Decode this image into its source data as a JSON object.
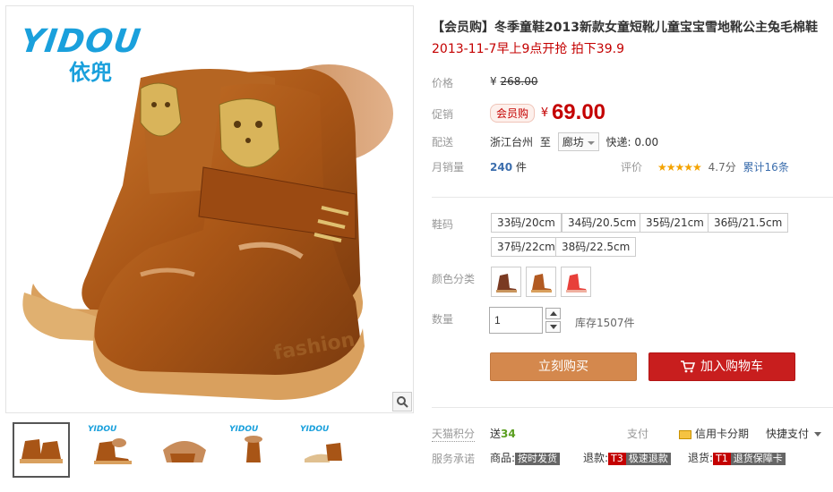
{
  "brand": {
    "logo_en": "YIDOU",
    "logo_cn": "依兜"
  },
  "product": {
    "title": "【会员购】冬季童鞋2013新款女童短靴儿童宝宝雪地靴公主兔毛棉鞋",
    "subtitle": "2013-11-7早上9点开抢 拍下39.9"
  },
  "price": {
    "label": "价格",
    "currency": "¥",
    "original": "268.00"
  },
  "promo": {
    "label": "促销",
    "tag": "会员购",
    "currency": "¥",
    "value": "69.00"
  },
  "shipping": {
    "label": "配送",
    "origin": "浙江台州",
    "to": "至",
    "destination": "廊坊",
    "fee": "快递: 0.00"
  },
  "sales": {
    "label": "月销量",
    "count": "240",
    "unit": "件",
    "rating_label": "评价",
    "stars": "★★★★★",
    "rating": 4.7,
    "rating_text": "4.7分",
    "reviews": "累计16条"
  },
  "sizes": {
    "label": "鞋码",
    "options": [
      "33码/20cm",
      "34码/20.5cm",
      "35码/21cm",
      "36码/21.5cm",
      "37码/22cm",
      "38码/22.5cm"
    ]
  },
  "colors": {
    "label": "颜色分类",
    "options": [
      "深棕",
      "浅棕",
      "红色"
    ],
    "swatch_colors": [
      "#7a3a22",
      "#b25a22",
      "#e8403a"
    ]
  },
  "quantity": {
    "label": "数量",
    "value": "1",
    "stock": "库存1507件"
  },
  "actions": {
    "buy": "立刻购买",
    "cart": "加入购物车"
  },
  "bottom": {
    "points_label": "天猫积分",
    "points_prefix": "送",
    "points_value": "34",
    "pay_label": "支付",
    "credit": "信用卡分期",
    "quick_pay": "快捷支付",
    "service_label": "服务承诺",
    "goods_label": "商品:",
    "goods_tag": "按时发货",
    "refund_label": "退款:",
    "refund_code": "T3",
    "refund_tag": "极速退款",
    "return_label": "退货:",
    "return_code": "T1",
    "return_tag": "退货保障卡"
  },
  "thumbs": {
    "logo": "YIDOU",
    "count": 5
  },
  "colors_theme": {
    "accent_red": "#c40000",
    "buy_orange": "#d4884d",
    "cart_red": "#c81e1e",
    "brand_blue": "#1aa0dc"
  }
}
